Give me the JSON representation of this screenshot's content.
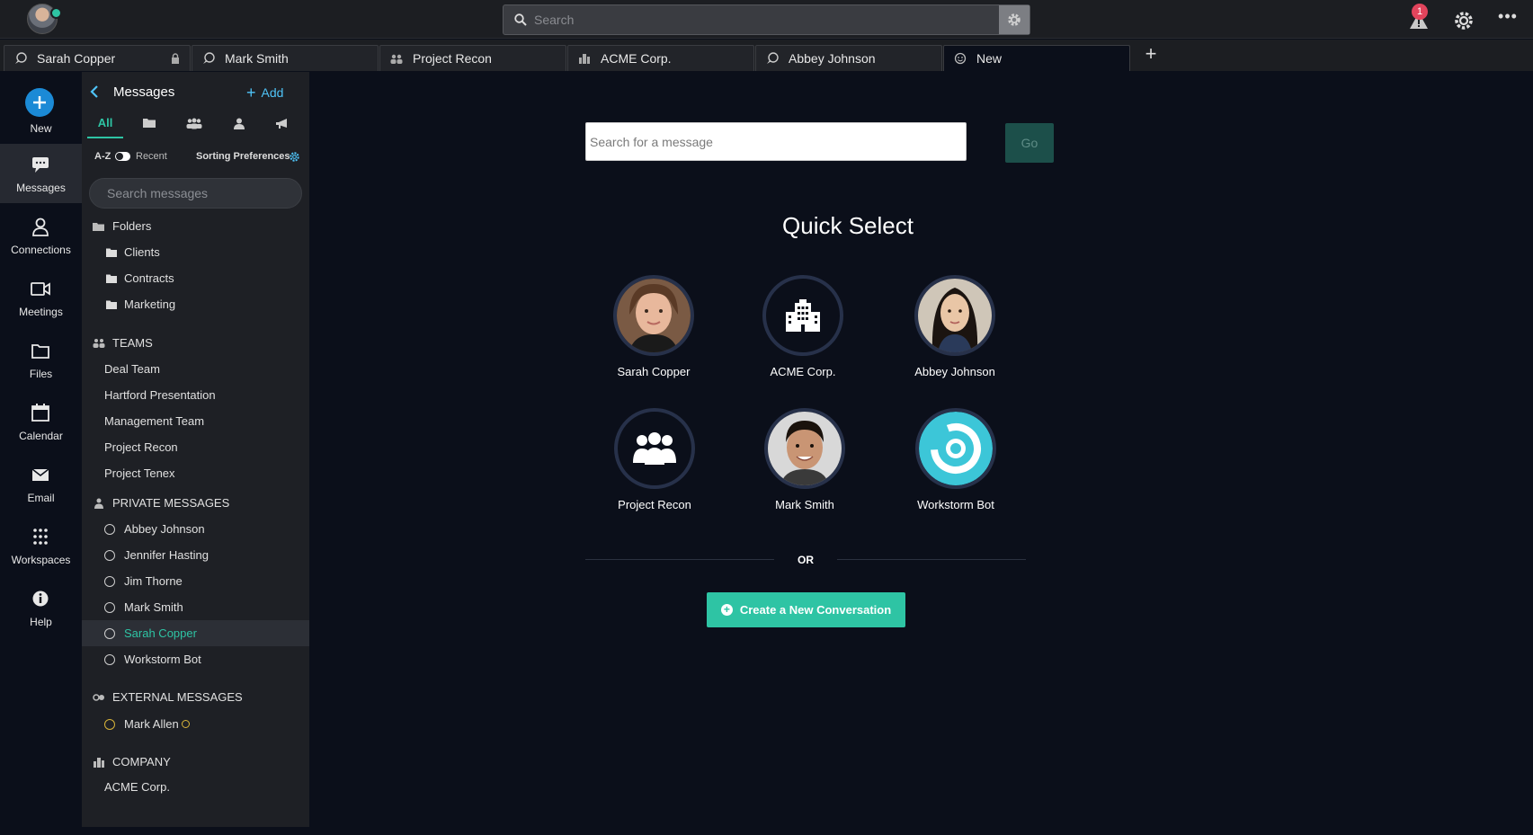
{
  "topbar": {
    "search_placeholder": "Search",
    "alert_count": "1",
    "more_label": "•••"
  },
  "tabs": [
    {
      "label": "Sarah Copper",
      "icon": "chat-icon",
      "locked": true
    },
    {
      "label": "Mark Smith",
      "icon": "chat-icon"
    },
    {
      "label": "Project Recon",
      "icon": "team-icon"
    },
    {
      "label": "ACME Corp.",
      "icon": "company-icon"
    },
    {
      "label": "Abbey Johnson",
      "icon": "chat-icon"
    },
    {
      "label": "New",
      "icon": "smiley-icon",
      "active": true
    }
  ],
  "new_tab_label": "+",
  "rail": {
    "new_label": "New",
    "items": [
      {
        "label": "Messages",
        "icon": "chat-bubble-icon",
        "active": true
      },
      {
        "label": "Connections",
        "icon": "person-icon"
      },
      {
        "label": "Meetings",
        "icon": "video-icon"
      },
      {
        "label": "Files",
        "icon": "folder-icon"
      },
      {
        "label": "Calendar",
        "icon": "calendar-icon"
      },
      {
        "label": "Email",
        "icon": "envelope-icon"
      },
      {
        "label": "Workspaces",
        "icon": "grid-icon"
      },
      {
        "label": "Help",
        "icon": "info-icon"
      }
    ]
  },
  "panel": {
    "title": "Messages",
    "add_label": "Add",
    "filter_all_label": "All",
    "sort_az": "A-Z",
    "sort_recent": "Recent",
    "sort_prefs": "Sorting Preferences",
    "search_placeholder": "Search messages",
    "folders_label": "Folders",
    "folders": [
      "Clients",
      "Contracts",
      "Marketing"
    ],
    "teams_label": "TEAMS",
    "teams": [
      "Deal Team",
      "Hartford Presentation",
      "Management Team",
      "Project Recon",
      "Project Tenex"
    ],
    "private_label": "PRIVATE MESSAGES",
    "private": [
      {
        "name": "Abbey Johnson"
      },
      {
        "name": "Jennifer Hasting"
      },
      {
        "name": "Jim Thorne"
      },
      {
        "name": "Mark Smith"
      },
      {
        "name": "Sarah Copper",
        "selected": true
      },
      {
        "name": "Workstorm Bot"
      }
    ],
    "external_label": "EXTERNAL MESSAGES",
    "external": [
      {
        "name": "Mark Allen"
      }
    ],
    "company_label": "COMPANY",
    "company": [
      "ACME Corp."
    ]
  },
  "main": {
    "search_placeholder": "Search for a message",
    "go_label": "Go",
    "quick_select_title": "Quick Select",
    "quick_select": [
      {
        "label": "Sarah Copper",
        "kind": "photo-woman"
      },
      {
        "label": "ACME Corp.",
        "kind": "building-icon"
      },
      {
        "label": "Abbey Johnson",
        "kind": "photo-woman-2"
      },
      {
        "label": "Project Recon",
        "kind": "team-icon"
      },
      {
        "label": "Mark Smith",
        "kind": "photo-man"
      },
      {
        "label": "Workstorm Bot",
        "kind": "bot-icon"
      }
    ],
    "or_label": "OR",
    "create_label": "Create a New Conversation"
  },
  "colors": {
    "accent": "#2ec4a4",
    "link": "#4fc3f7",
    "background": "#0b0f1a",
    "panel": "#1e2025"
  }
}
